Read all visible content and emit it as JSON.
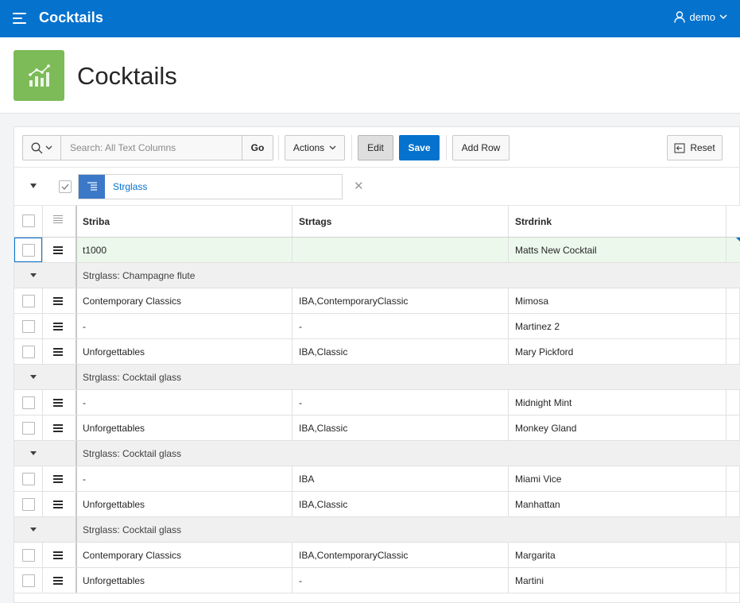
{
  "app": {
    "title": "Cocktails",
    "user": "demo"
  },
  "page": {
    "title": "Cocktails"
  },
  "toolbar": {
    "search_placeholder": "Search: All Text Columns",
    "go_label": "Go",
    "actions_label": "Actions",
    "edit_label": "Edit",
    "save_label": "Save",
    "add_row_label": "Add Row",
    "reset_label": "Reset"
  },
  "filter": {
    "label": "Strglass"
  },
  "columns": {
    "striba": "Striba",
    "strtags": "Strtags",
    "strdrink": "Strdrink"
  },
  "colors": {
    "header": "#0572ce",
    "hero_icon": "#7cbb58",
    "save": "#0572ce",
    "selected_row": "#ecf8ec"
  },
  "rows": [
    {
      "type": "data",
      "selected": true,
      "striba": "t1000",
      "strtags": "",
      "strdrink": "Matts New Cocktail"
    },
    {
      "type": "group",
      "label": "Strglass: Champagne flute"
    },
    {
      "type": "data",
      "striba": "Contemporary Classics",
      "strtags": "IBA,ContemporaryClassic",
      "strdrink": "Mimosa"
    },
    {
      "type": "data",
      "striba": "-",
      "strtags": "-",
      "strdrink": "Martinez 2"
    },
    {
      "type": "data",
      "striba": "Unforgettables",
      "strtags": "IBA,Classic",
      "strdrink": "Mary Pickford"
    },
    {
      "type": "group",
      "label": "Strglass: Cocktail glass"
    },
    {
      "type": "data",
      "striba": "-",
      "strtags": "-",
      "strdrink": "Midnight Mint"
    },
    {
      "type": "data",
      "striba": "Unforgettables",
      "strtags": "IBA,Classic",
      "strdrink": "Monkey Gland"
    },
    {
      "type": "group",
      "label": "Strglass: Cocktail glass"
    },
    {
      "type": "data",
      "striba": "-",
      "strtags": "IBA",
      "strdrink": "Miami Vice"
    },
    {
      "type": "data",
      "striba": "Unforgettables",
      "strtags": "IBA,Classic",
      "strdrink": "Manhattan"
    },
    {
      "type": "group",
      "label": "Strglass: Cocktail glass"
    },
    {
      "type": "data",
      "striba": "Contemporary Classics",
      "strtags": "IBA,ContemporaryClassic",
      "strdrink": "Margarita"
    },
    {
      "type": "data",
      "striba": "Unforgettables",
      "strtags": "-",
      "strdrink": "Martini"
    }
  ]
}
